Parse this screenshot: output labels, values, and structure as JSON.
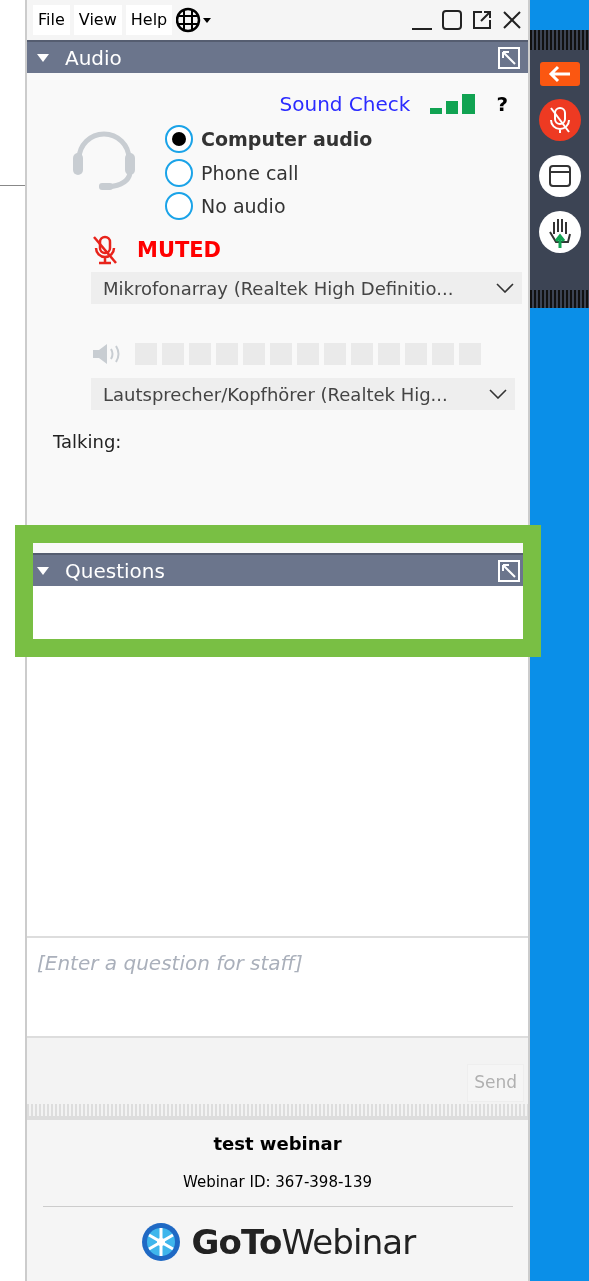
{
  "menu": [
    "File",
    "View",
    "Help"
  ],
  "audio": {
    "title": "Audio",
    "sound_check": "Sound Check",
    "help": "?",
    "options": [
      {
        "label": "Computer audio",
        "selected": true
      },
      {
        "label": "Phone call",
        "selected": false
      },
      {
        "label": "No audio",
        "selected": false
      }
    ],
    "mic": {
      "muted": true,
      "status": "MUTED",
      "device": "Mikrofonarray (Realtek High Definitio..."
    },
    "speaker": {
      "level": 0,
      "device": "Lautsprecher/Kopfhörer (Realtek Hig..."
    },
    "talking": "Talking:"
  },
  "questions": {
    "title": "Questions",
    "placeholder": "[Enter a question for staff]",
    "send": "Send"
  },
  "footer": {
    "title": "test webinar",
    "webinar_id": "Webinar ID: 367-398-139",
    "logo": "**GoTo**Webinar"
  }
}
